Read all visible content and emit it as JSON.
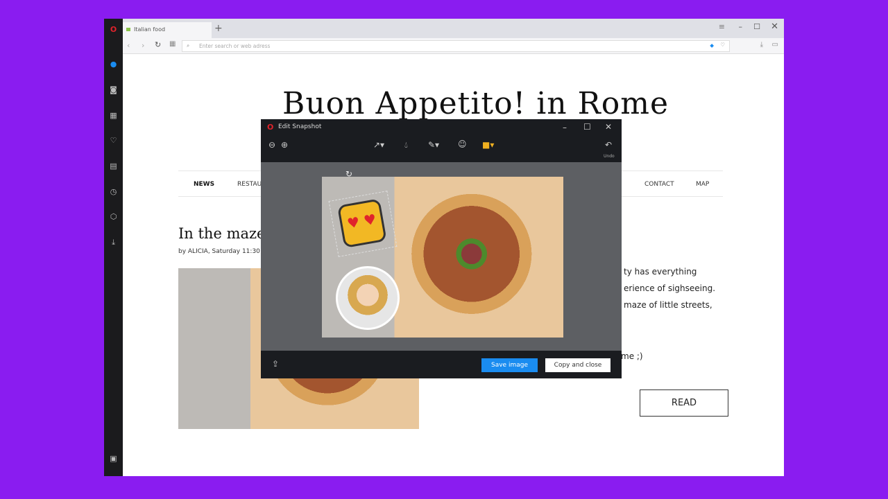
{
  "browser": {
    "tab_title": "Italian food",
    "new_tab": "+",
    "address_placeholder": "Enter search or web adress"
  },
  "page": {
    "title": "Buon Appetito! in Rome",
    "nav": [
      "NEWS",
      "RESTAURANTS",
      "CONTACT",
      "MAP"
    ],
    "article_title": "In the maze",
    "byline": "by ALICIA, Saturday 11:30",
    "body_lines": [
      "ty has everything",
      "erience of sighseeing.",
      "maze of little streets,",
      "me ;)"
    ],
    "read_button": "READ"
  },
  "dialog": {
    "title": "Edit Snapshot",
    "undo_label": "Undo",
    "save_button": "Save image",
    "copy_button": "Copy and close"
  },
  "colors": {
    "background": "#8a1cf0",
    "accent": "#1a8cf0",
    "opera_red": "#e0232b"
  }
}
